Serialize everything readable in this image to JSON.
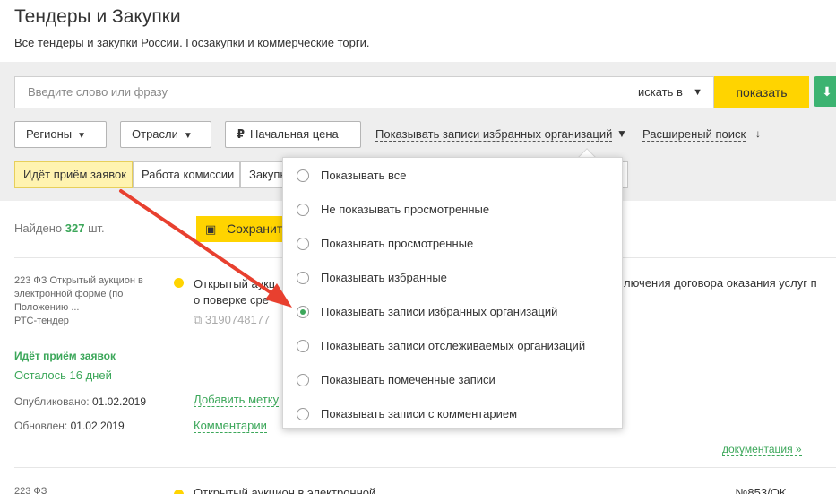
{
  "header": {
    "title": "Тендеры и Закупки",
    "subtitle": "Все тендеры и закупки России. Госзакупки и коммерческие торги."
  },
  "search": {
    "placeholder": "Введите слово или фразу",
    "search_in_label": "искать в",
    "show_button": "показать"
  },
  "filters": {
    "regions": "Регионы",
    "industries": "Отрасли",
    "start_price": "Начальная цена",
    "favorites_link": "Показывать записи избранных организаций",
    "advanced_search": "Расширеный поиск"
  },
  "tabs": [
    {
      "label": "Идёт приём заявок",
      "active": true
    },
    {
      "label": "Работа комиссии",
      "active": false
    },
    {
      "label": "Закупка",
      "active": false
    }
  ],
  "results": {
    "found_prefix": "Найдено",
    "count": "327",
    "found_suffix": "шт.",
    "save_button": "Сохранит"
  },
  "record": {
    "law_line1": "223 ФЗ Открытый аукцион в",
    "law_line2": "электронной форме (по",
    "law_line3": "Положению ...",
    "law_line4": "РТС-тендер",
    "title_line1": "Открытый аукц",
    "title_line2": "о поверке сре",
    "title_right": "лючения договора оказания услуг п",
    "reg_number": "3190748177",
    "status": "Идёт приём заявок",
    "remaining": "Осталось 16 дней",
    "published_label": "Опубликовано:",
    "published_date": "01.02.2019",
    "updated_label": "Обновлен:",
    "updated_date": "01.02.2019",
    "add_tag": "Добавить метку",
    "comments": "Комментарии",
    "docs": "документация"
  },
  "record2": {
    "law": "223 ФЗ",
    "title": "Открытый аукцион в электронной",
    "right": "... №853/ОК"
  },
  "dropdown": {
    "options": [
      {
        "label": "Показывать все",
        "checked": false
      },
      {
        "label": "Не показывать просмотренные",
        "checked": false
      },
      {
        "label": "Показывать просмотренные",
        "checked": false
      },
      {
        "label": "Показывать избранные",
        "checked": false
      },
      {
        "label": "Показывать записи избранных организаций",
        "checked": true
      },
      {
        "label": "Показывать записи отслеживаемых организаций",
        "checked": false
      },
      {
        "label": "Показывать помеченные записи",
        "checked": false
      },
      {
        "label": "Показывать записи с комментарием",
        "checked": false
      }
    ]
  },
  "colors": {
    "accent_yellow": "#ffd400",
    "accent_green": "#3ca75a",
    "annotation_arrow": "#e8402f"
  }
}
